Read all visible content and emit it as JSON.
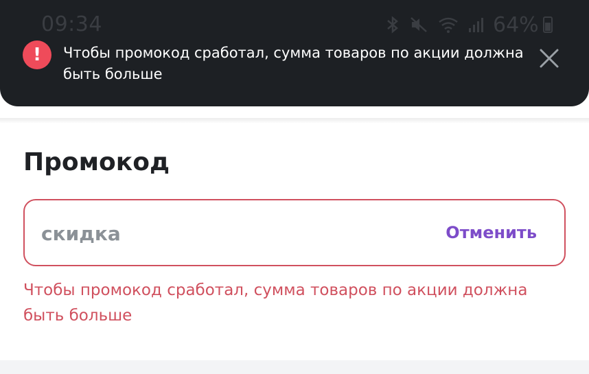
{
  "status_bar": {
    "time": "09:34",
    "battery": "64%",
    "icons": [
      "bluetooth-icon",
      "mute-icon",
      "wifi-icon",
      "signal-icon",
      "battery-icon"
    ]
  },
  "toast": {
    "message": "Чтобы промокод сработал, сумма товаров по акции должна быть больше",
    "icon": "alert-icon",
    "close_icon": "close-icon"
  },
  "promo": {
    "title": "Промокод",
    "value": "скидка",
    "cancel_label": "Отменить",
    "error": "Чтобы промокод сработал, сумма товаров по акции должна быть больше"
  },
  "colors": {
    "toast_bg": "#1d2024",
    "alert": "#ef4b5a",
    "error": "#d0505e",
    "accent": "#7d4cc9"
  }
}
